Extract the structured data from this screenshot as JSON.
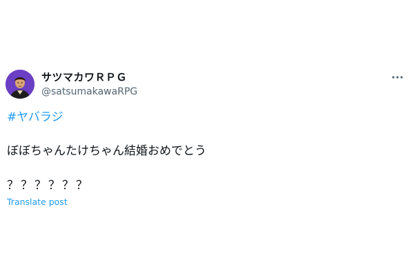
{
  "tweet": {
    "author": {
      "display_name": "サツマカワＲＰＧ",
      "handle": "@satsumakawaRPG",
      "avatar_icon": "avatar-photo",
      "avatar_bg": "#6a3fc4"
    },
    "more_icon": "more-dots-icon",
    "hashtag": "#ヤバラジ",
    "body_lines": [
      "ぼぼちゃんたけちゃん結婚おめでとう",
      "？？？？？？"
    ],
    "translate_label": "Translate post"
  },
  "colors": {
    "accent": "#1d9bf0",
    "text": "#0f1419",
    "muted": "#536471"
  }
}
